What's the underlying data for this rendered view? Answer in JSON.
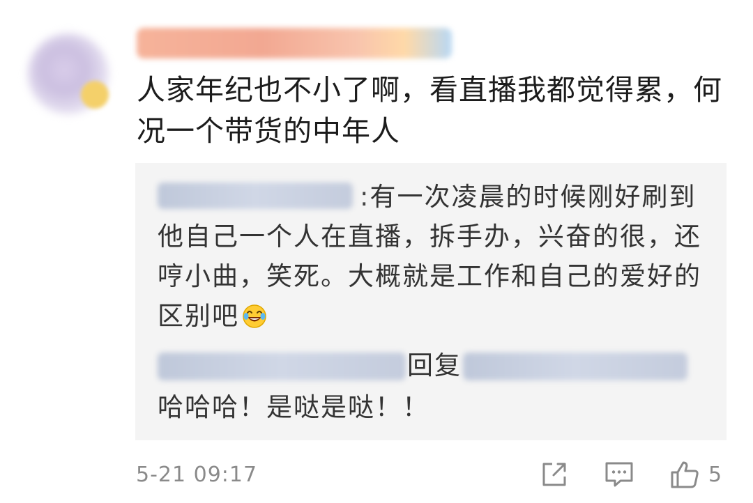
{
  "comment": {
    "text": "人家年纪也不小了啊，看直播我都觉得累，何况一个带货的中年人"
  },
  "replies": [
    {
      "text": "有一次凌晨的时候刚好刷到他自己一个人在直播，拆手办，兴奋的很，还哼小曲，笑死。大概就是工作和自己的爱好的区别吧",
      "colon": ":",
      "emoji": "laughing-tears-emoji"
    },
    {
      "reply_word": "回复",
      "text": "哈哈哈！是哒是哒！！"
    }
  ],
  "footer": {
    "timestamp": "5-21 09:17",
    "like_count": "5",
    "icons": [
      "share-icon",
      "comment-icon",
      "like-icon"
    ]
  },
  "colors": {
    "reply_background": "#f4f4f4",
    "secondary_text": "#8a8a8a",
    "primary_text": "#1c1c1c"
  }
}
